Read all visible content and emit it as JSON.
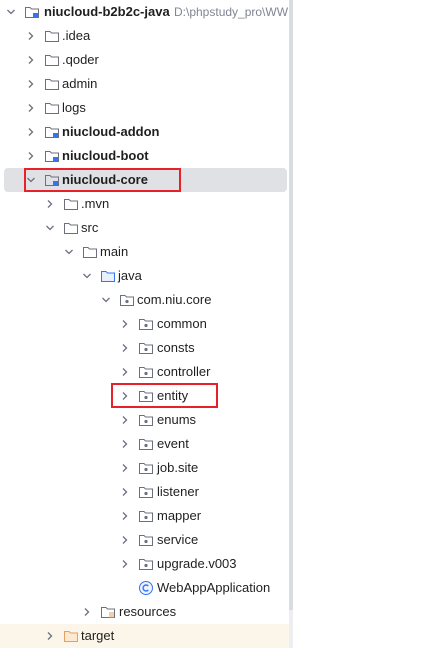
{
  "tree": {
    "root": {
      "label": "niucloud-b2b2c-java",
      "path": "D:\\phpstudy_pro\\WW"
    },
    "items": [
      {
        "label": ".idea"
      },
      {
        "label": ".qoder"
      },
      {
        "label": "admin"
      },
      {
        "label": "logs"
      },
      {
        "label": "niucloud-addon"
      },
      {
        "label": "niucloud-boot"
      },
      {
        "label": "niucloud-core"
      },
      {
        "label": ".mvn"
      },
      {
        "label": "src"
      },
      {
        "label": "main"
      },
      {
        "label": "java"
      },
      {
        "label": "com.niu.core"
      },
      {
        "label": "common"
      },
      {
        "label": "consts"
      },
      {
        "label": "controller"
      },
      {
        "label": "entity"
      },
      {
        "label": "enums"
      },
      {
        "label": "event"
      },
      {
        "label": "job.site"
      },
      {
        "label": "listener"
      },
      {
        "label": "mapper"
      },
      {
        "label": "service"
      },
      {
        "label": "upgrade.v003"
      },
      {
        "label": "WebAppApplication"
      },
      {
        "label": "resources"
      },
      {
        "label": "target"
      }
    ]
  },
  "colors": {
    "folder": "#6c707e",
    "module_folder": "#6c707e",
    "source_folder": "#3574f0",
    "resources_folder": "#6c707e",
    "excluded_folder": "#e6a05a",
    "class_icon": "#3574f0",
    "selection": "#dfe1e5",
    "highlight_box": "#e8202a"
  },
  "icons": {
    "expanded": "chevron-down-icon",
    "collapsed": "chevron-right-icon",
    "folder": "folder-icon",
    "module": "module-folder-icon",
    "source": "source-folder-icon",
    "package": "package-icon",
    "class": "class-icon",
    "resources": "resources-folder-icon",
    "excluded": "excluded-folder-icon"
  }
}
